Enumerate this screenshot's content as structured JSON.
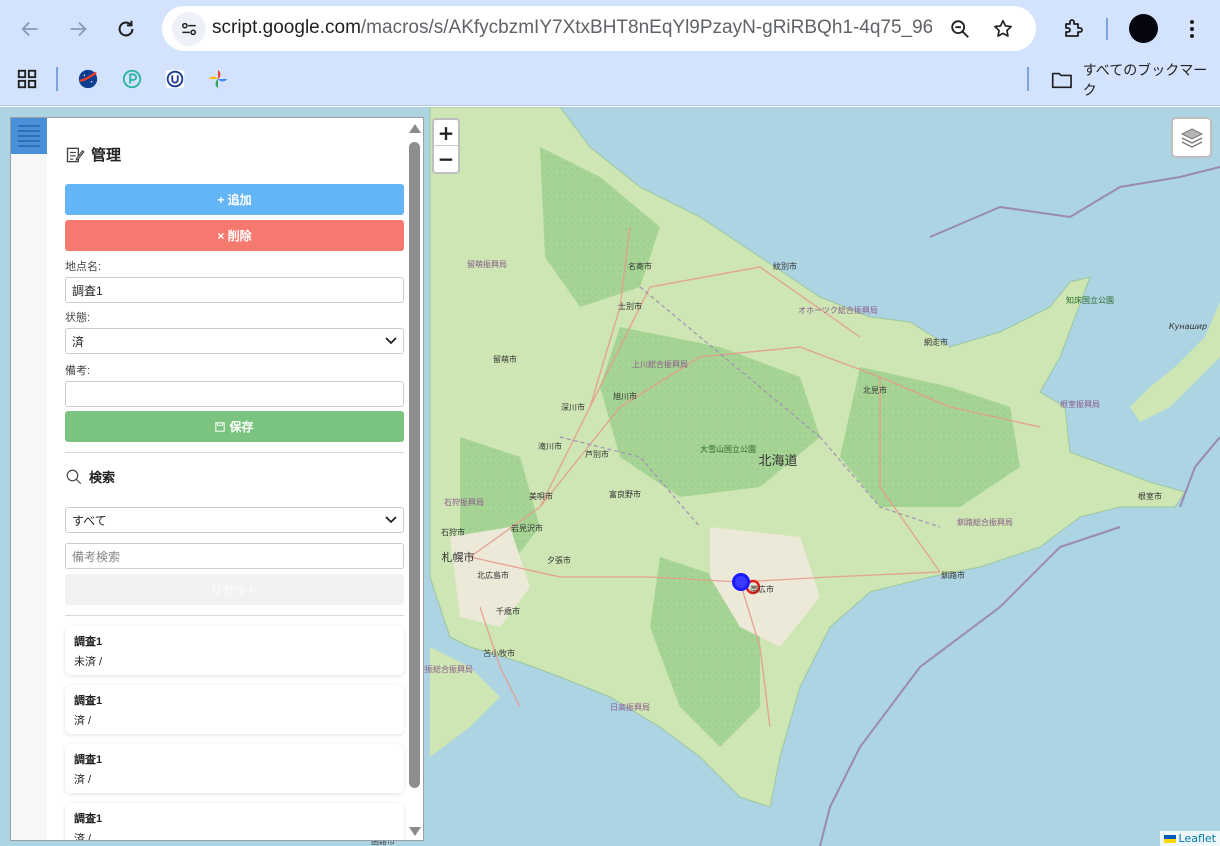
{
  "browser": {
    "url_host": "script.google.com",
    "url_path": "/macros/s/AKfycbzmIY7XtxBHT8nEqYl9PzayN-gRiRBQh1-4q75_96T…",
    "bookmarks_all_label": "すべてのブックマーク",
    "bookmarks": [
      "apps-icon",
      "nasa-icon",
      "p-circle-icon",
      "u-logo-icon",
      "pinwheel-icon"
    ]
  },
  "panel": {
    "manage_title": "管理",
    "add_label": "+ 追加",
    "delete_label": "× 削除",
    "name_label": "地点名:",
    "name_value": "調査1",
    "status_label": "状態:",
    "status_value": "済",
    "note_label": "備考:",
    "note_value": "",
    "save_label": "保存",
    "search_title": "検索",
    "filter_value": "すべて",
    "search_placeholder": "備考検索",
    "reset_label": "リセット",
    "items": [
      {
        "title": "調査1",
        "sub": "未済 /"
      },
      {
        "title": "調査1",
        "sub": "済 /"
      },
      {
        "title": "調査1",
        "sub": "済 /"
      },
      {
        "title": "調査1",
        "sub": "済 /"
      }
    ]
  },
  "map": {
    "zoom_in": "+",
    "zoom_out": "−",
    "attribution": "Leaflet",
    "colors": {
      "sea": "#acd4e2",
      "land": "#cfe6b7",
      "forest": "#9ccf8c",
      "marker_blue": "#1a1aff",
      "marker_red": "#e0201a"
    },
    "labels": {
      "region": "北海道",
      "nayoro": "名寄市",
      "monbetsu": "紋別市",
      "shibetsu": "士別市",
      "okhotsk": "オホーツク総合振興局",
      "shiretoko": "知床国立公園",
      "kunashir": "Кунашир",
      "abashiri": "網走市",
      "rumoi": "留萌市",
      "rumoi_sub": "留萌振興局",
      "kamikawa": "上川総合振興局",
      "asahikawa": "旭川市",
      "fukagawa": "深川市",
      "kitami": "北見市",
      "nemuro_sub": "根室振興局",
      "daisetsu": "大雪山国立公園",
      "takikawa": "滝川市",
      "ashibetsu": "芦別市",
      "ishikari_sub": "石狩振興局",
      "bibai": "美唄市",
      "furano": "富良野市",
      "nemuro": "根室市",
      "ishikari": "石狩市",
      "iwamizawa": "岩見沢市",
      "kushiro_sub": "釧路総合振興局",
      "sapporo": "札幌市",
      "yubari": "夕張市",
      "kitahiroshima": "北広島市",
      "obihiro": "帯広市",
      "kushiro": "釧路市",
      "chitose": "千歳市",
      "tomakomai": "苫小牧市",
      "iburi": "胆振総合振興局",
      "hidaka": "日高振興局",
      "hakodate": "函館市"
    }
  }
}
